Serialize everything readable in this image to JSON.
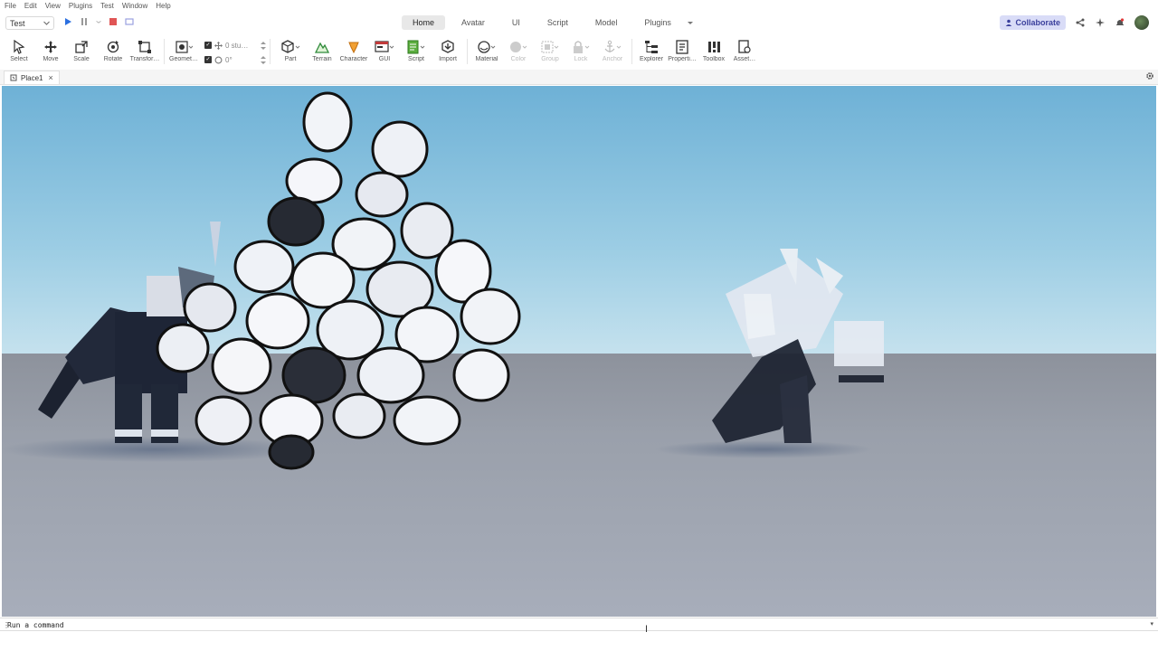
{
  "menu": [
    "File",
    "Edit",
    "View",
    "Plugins",
    "Test",
    "Window",
    "Help"
  ],
  "header": {
    "place_select": "Test",
    "tabs": [
      {
        "label": "Home",
        "active": true
      },
      {
        "label": "Avatar",
        "active": false
      },
      {
        "label": "UI",
        "active": false
      },
      {
        "label": "Script",
        "active": false
      },
      {
        "label": "Model",
        "active": false
      },
      {
        "label": "Plugins",
        "active": false
      }
    ],
    "collaborate_label": "Collaborate"
  },
  "toolbar": {
    "select": "Select",
    "move": "Move",
    "scale": "Scale",
    "rotate": "Rotate",
    "transform": "Transfor…",
    "geometry": "Geomet…",
    "snap_move": "0 stu…",
    "snap_rotate": "0°",
    "part": "Part",
    "terrain": "Terrain",
    "character": "Character",
    "gui": "GUI",
    "script": "Script",
    "import": "Import",
    "material": "Material",
    "color": "Color",
    "group": "Group",
    "lock": "Lock",
    "anchor": "Anchor",
    "explorer": "Explorer",
    "properties": "Properti…",
    "toolbox": "Toolbox",
    "asset": "Asset…"
  },
  "document": {
    "tab_label": "Place1"
  },
  "command_bar": {
    "placeholder": "Run a command"
  },
  "colors": {
    "accent": "#3a3f9c",
    "collaborate_bg": "#d9dcf7",
    "play_blue": "#2b6fe0",
    "stop_red": "#e05555",
    "sky_top": "#6eb1d6",
    "ground": "#9aa0ab"
  }
}
